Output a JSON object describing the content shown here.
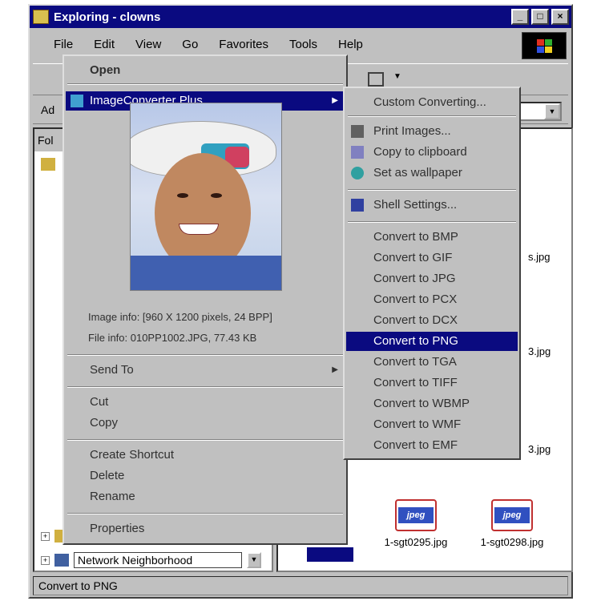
{
  "window": {
    "title": "Exploring - clowns"
  },
  "titlebar_buttons": {
    "minimize": "_",
    "maximize": "□",
    "close": "×"
  },
  "menubar": [
    "File",
    "Edit",
    "View",
    "Go",
    "Favorites",
    "Tools",
    "Help"
  ],
  "address_label": "Ad",
  "left_pane": {
    "header": "Fol",
    "tree_bottom": "Network Neighborhood"
  },
  "files": [
    {
      "name": "1-sgt0295.jpg"
    },
    {
      "name": "1-sgt0298.jpg"
    }
  ],
  "right_stubs": [
    "s.jpg",
    "3.jpg",
    "3.jpg"
  ],
  "statusbar": "Convert to PNG",
  "context_menu": {
    "open": "Open",
    "plugin": "ImageConverter Plus",
    "image_info": "Image info: [960 X 1200 pixels, 24 BPP]",
    "file_info": "File info: 010PP1002.JPG, 77.43 KB",
    "send_to": "Send To",
    "cut": "Cut",
    "copy": "Copy",
    "create_shortcut": "Create Shortcut",
    "delete": "Delete",
    "rename": "Rename",
    "properties": "Properties"
  },
  "submenu": {
    "custom": "Custom Converting...",
    "print": "Print Images...",
    "clipboard": "Copy to clipboard",
    "wallpaper": "Set as wallpaper",
    "shell": "Shell Settings...",
    "convert": [
      "Convert to BMP",
      "Convert to GIF",
      "Convert to JPG",
      "Convert to PCX",
      "Convert to DCX",
      "Convert to PNG",
      "Convert to TGA",
      "Convert to TIFF",
      "Convert to WBMP",
      "Convert to WMF",
      "Convert to EMF"
    ],
    "selected": "Convert to PNG"
  },
  "colors": {
    "selection": "#0a0a80",
    "face": "#c0c0c0"
  }
}
